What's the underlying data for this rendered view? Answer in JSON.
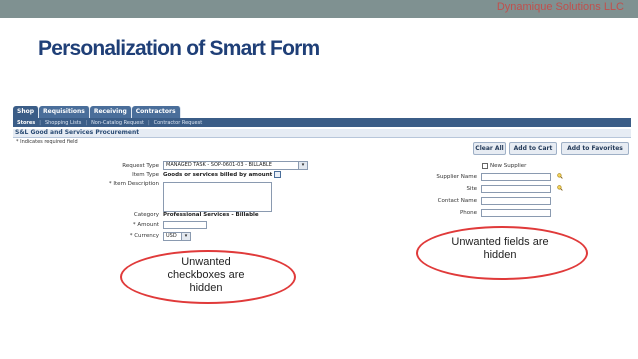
{
  "brand": "Dynamique Solutions LLC",
  "title": "Personalization of Smart Form",
  "app": {
    "tabs": [
      {
        "label": "Shop",
        "active": true
      },
      {
        "label": "Requisitions",
        "active": false
      },
      {
        "label": "Receiving",
        "active": false
      },
      {
        "label": "Contractors",
        "active": false
      }
    ],
    "subnav": [
      {
        "label": "Stores",
        "active": true
      },
      {
        "label": "Shopping Lists",
        "active": false
      },
      {
        "label": "Non-Catalog Request",
        "active": false
      },
      {
        "label": "Contractor Request",
        "active": false
      }
    ],
    "page_heading": "S&L Good and Services Procurement",
    "required_note": "* Indicates required field",
    "buttons": {
      "clear_all": "Clear All",
      "add_to_cart": "Add to Cart",
      "add_to_favorites": "Add to Favorites"
    },
    "form": {
      "request_type_label": "Request Type",
      "request_type_value": "MANAGED TASK - SOP-0601-03 - BILLABLE",
      "item_type_label": "Item Type",
      "item_type_value": "Goods or services billed by amount",
      "item_description_label": "* Item Description",
      "category_label": "Category",
      "category_value": "Professional Services - Billable",
      "amount_label": "* Amount",
      "currency_label": "* Currency",
      "currency_value": "USD"
    },
    "supplier": {
      "new_supplier_label": "New Supplier",
      "supplier_name_label": "Supplier Name",
      "site_label": "Site",
      "contact_name_label": "Contact Name",
      "phone_label": "Phone"
    }
  },
  "callouts": {
    "left": "Unwanted checkboxes are hidden",
    "right": "Unwanted fields are hidden"
  },
  "colors": {
    "accent_red": "#e03a3a",
    "title_blue": "#1f3f77",
    "tab_blue": "#3b5d87",
    "top_bar": "#7f9191"
  }
}
